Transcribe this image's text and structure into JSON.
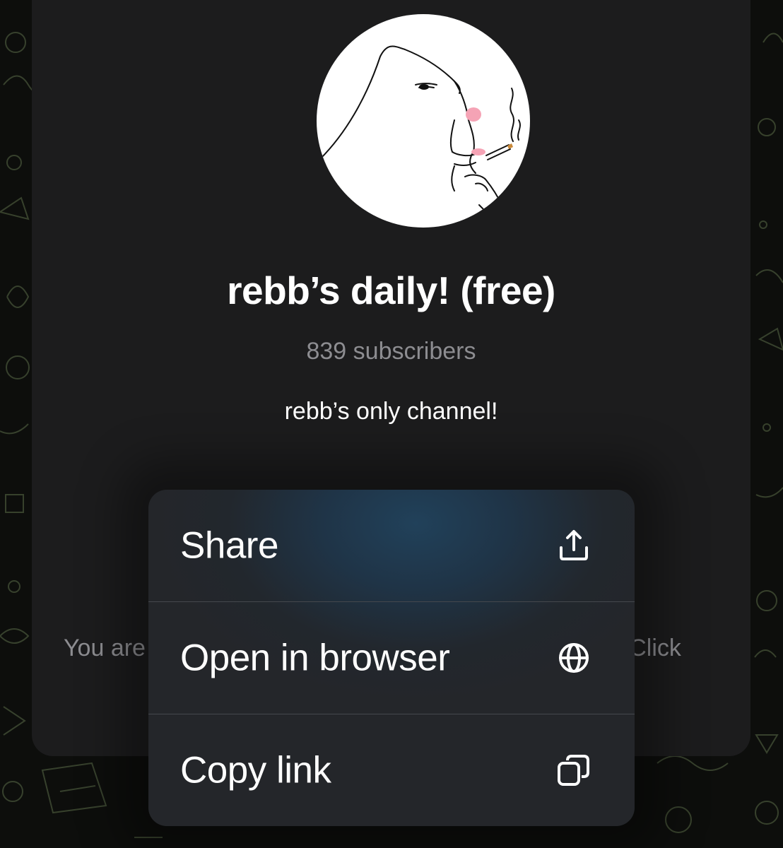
{
  "channel": {
    "title": "rebb’s daily! (free)",
    "subscribers": "839 subscribers",
    "description": "rebb’s only channel!",
    "notice_left": "You are",
    "notice_right": "). Click"
  },
  "menu": {
    "items": [
      {
        "label": "Share",
        "icon": "share-icon"
      },
      {
        "label": "Open in browser",
        "icon": "globe-icon"
      },
      {
        "label": "Copy link",
        "icon": "copy-icon"
      }
    ]
  },
  "colors": {
    "card_bg": "#1c1c1d",
    "title": "#ffffff",
    "subtitle": "#8d8d91",
    "menu_tint": "#21415a"
  }
}
